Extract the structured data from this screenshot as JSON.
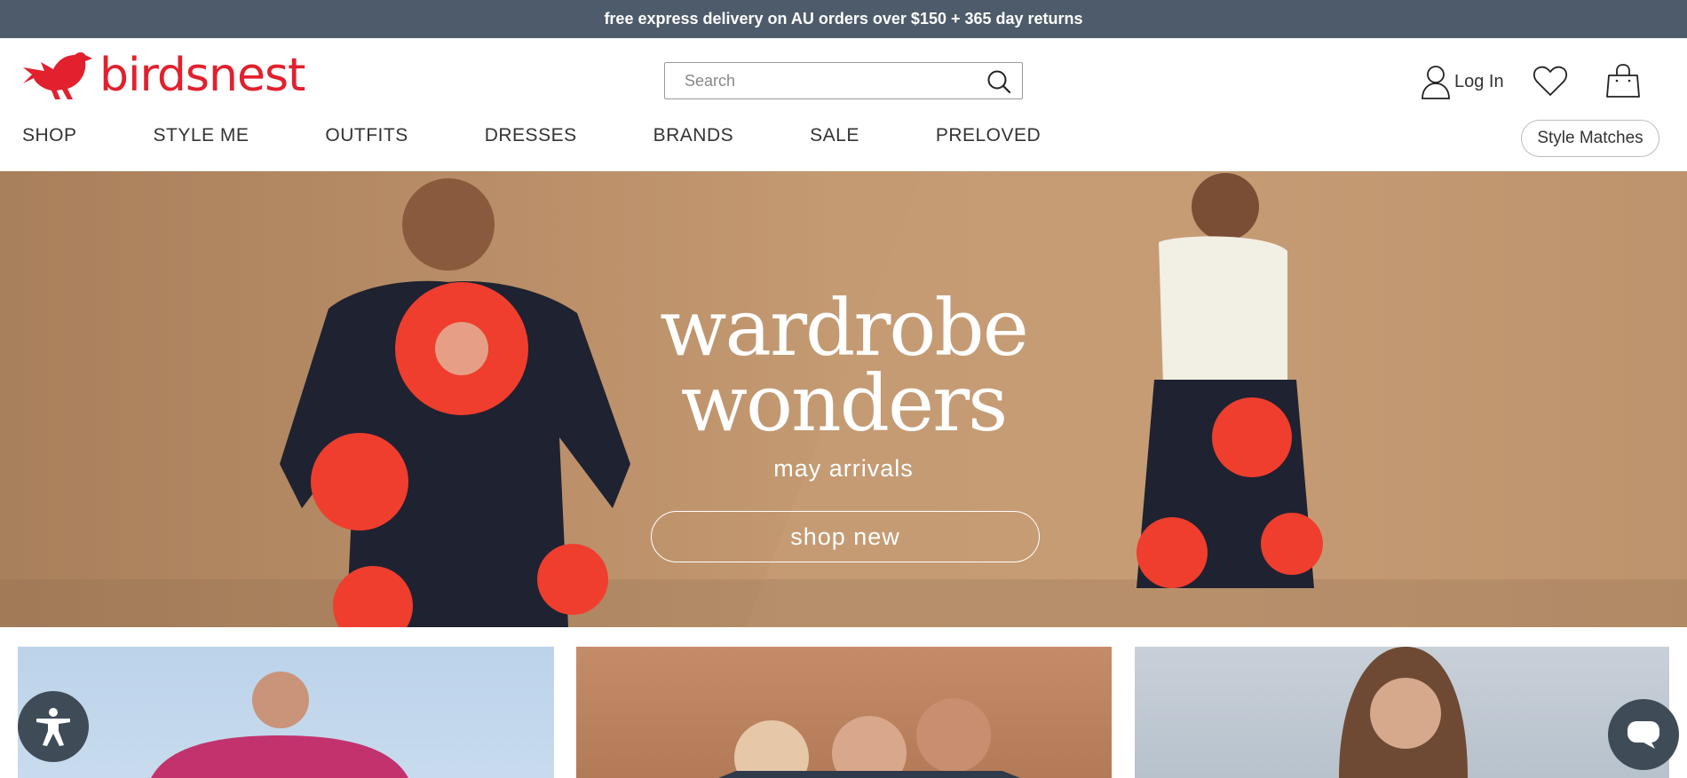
{
  "promo": {
    "text": "free express delivery on AU orders over $150 + 365 day returns"
  },
  "header": {
    "logo_text": "birdsnest",
    "search": {
      "placeholder": "Search",
      "value": ""
    },
    "login_label": "Log In"
  },
  "nav": {
    "items": [
      "SHOP",
      "STYLE ME",
      "OUTFITS",
      "DRESSES",
      "BRANDS",
      "SALE",
      "PRELOVED"
    ],
    "style_matches_label": "Style Matches"
  },
  "hero": {
    "title_line1": "wardrobe",
    "title_line2": "wonders",
    "subtitle": "may arrivals",
    "cta_label": "shop new"
  },
  "colors": {
    "brand_red": "#e2202e",
    "promo_bar": "#4d5b6a",
    "hero_bg": "#b98e68",
    "floating_button": "#3f4c58"
  },
  "icons": {
    "logo": "bird-logo-icon",
    "search": "search-icon",
    "account": "user-icon",
    "wishlist": "heart-icon",
    "cart": "shopping-bag-icon",
    "accessibility": "accessibility-icon",
    "chat": "chat-icon"
  }
}
